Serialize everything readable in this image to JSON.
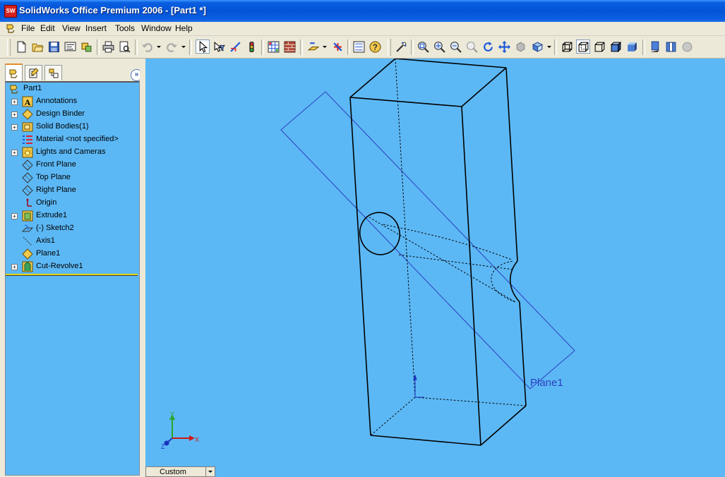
{
  "window": {
    "title": "SolidWorks Office Premium 2006 - [Part1 *]",
    "app_icon": "SW"
  },
  "menu": [
    "File",
    "Edit",
    "View",
    "Insert",
    "Tools",
    "Window",
    "Help"
  ],
  "feature_tree": {
    "root": "Part1",
    "items": [
      {
        "label": "Annotations",
        "icon": "annotations-icon",
        "expandable": true
      },
      {
        "label": "Design Binder",
        "icon": "design-binder-icon",
        "expandable": true
      },
      {
        "label": "Solid Bodies(1)",
        "icon": "solid-bodies-icon",
        "expandable": true
      },
      {
        "label": "Material <not specified>",
        "icon": "material-icon",
        "expandable": false
      },
      {
        "label": "Lights and Cameras",
        "icon": "lights-icon",
        "expandable": true
      },
      {
        "label": "Front Plane",
        "icon": "plane-icon",
        "expandable": false
      },
      {
        "label": "Top Plane",
        "icon": "plane-icon",
        "expandable": false
      },
      {
        "label": "Right Plane",
        "icon": "plane-icon",
        "expandable": false
      },
      {
        "label": "Origin",
        "icon": "origin-icon",
        "expandable": false
      },
      {
        "label": "Extrude1",
        "icon": "extrude-icon",
        "expandable": true
      },
      {
        "label": "(-) Sketch2",
        "icon": "sketch-icon",
        "expandable": false
      },
      {
        "label": "Axis1",
        "icon": "axis-icon",
        "expandable": false
      },
      {
        "label": "Plane1",
        "icon": "plane-feature-icon",
        "expandable": false
      },
      {
        "label": "Cut-Revolve1",
        "icon": "cut-revolve-icon",
        "expandable": true
      }
    ]
  },
  "viewport": {
    "plane_label": "Plane1",
    "triad": {
      "x": "X",
      "y": "Y",
      "z": "Z"
    },
    "view_orientation": "Custom"
  },
  "colors": {
    "viewport_bg": "#5cb8f5",
    "titlebar": "#0453d6",
    "plane_line": "#2c3fc0"
  }
}
